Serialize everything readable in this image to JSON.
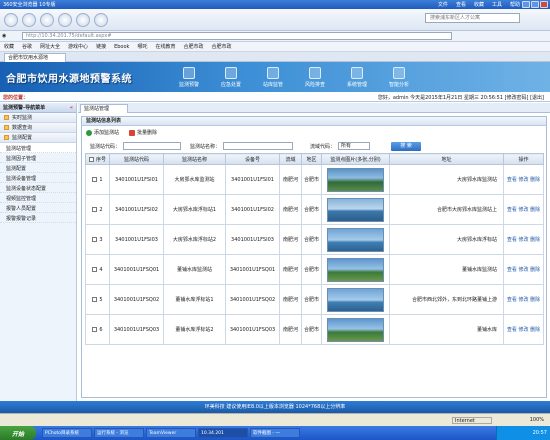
{
  "browser": {
    "title": "360安全浏览器 10专版",
    "menus": [
      "文件",
      "查看",
      "收藏",
      "工具",
      "帮助"
    ],
    "url": "http://10.34.201.75/default.aspx#",
    "search_placeholder": "搜索浦东新区人才公寓",
    "favorites": [
      "收藏",
      "谷歌",
      "网址大全",
      "游戏中心",
      "链接",
      "Ebook",
      "哪吒",
      "在线教育",
      "合肥市政",
      "合肥市政"
    ],
    "tab_label": "合肥市饮用水源地"
  },
  "banner": {
    "system_title": "合肥市饮用水源地预警系统",
    "nav": [
      "监测预警",
      "应急处置",
      "站库监管",
      "风险排查",
      "系统管理",
      "智能分析"
    ]
  },
  "status": {
    "location": "您的位置：",
    "user": "您好，admin 今天是2015年1月21日 星期三 20:56:51  [修改密码]  [退出]"
  },
  "sidebar": {
    "header": "监测预警-导航菜单",
    "toggle": "«",
    "groups": [
      "实时监测",
      "数据查询",
      "监测配置"
    ],
    "items": [
      "监测站管理",
      "监测因子管理",
      "监测配置",
      "监测设备管理",
      "监测设备状态配置",
      "视频监控管理",
      "报警人员配置",
      "报警报警记录"
    ]
  },
  "main": {
    "tab": "监测站管理",
    "panel_title": "监测站信息列表",
    "add_label": "添加监测站",
    "del_label": "批量删除",
    "filter_code_label": "监测站代码：",
    "filter_name_label": "监测站名称：",
    "filter_basin_label": "流域代码：",
    "filter_basin_value": "所有",
    "search_btn": "搜 索"
  },
  "table": {
    "headers": [
      "序号",
      "监测站代码",
      "监测站名称",
      "设备号",
      "流域",
      "地区",
      "监测点图片(多张,分别)",
      "地址",
      "操作"
    ],
    "rows": [
      {
        "no": "1",
        "code": "3401001U1FSI01",
        "name": "大房郢水库监测站",
        "dev": "3401001U1FSI01",
        "basin": "南肥河",
        "area": "合肥市",
        "addr": "大房郢水库监测站",
        "ops": "查看 修改 删除"
      },
      {
        "no": "2",
        "code": "3401001U1FSI02",
        "name": "大房郢水库浮标站1",
        "dev": "3401001U1FSI02",
        "basin": "南肥河",
        "area": "合肥市",
        "addr": "合肥市大房郢水库监测站上",
        "ops": "查看 修改 删除"
      },
      {
        "no": "3",
        "code": "3401001U1FSI03",
        "name": "大房郢水库浮标站2",
        "dev": "3401001U1FSI03",
        "basin": "南肥河",
        "area": "合肥市",
        "addr": "大房郢水库浮标站",
        "ops": "查看 修改 删除"
      },
      {
        "no": "4",
        "code": "3401001U1FSQ01",
        "name": "董铺水库监测站",
        "dev": "3401001U1FSQ01",
        "basin": "南肥河",
        "area": "合肥市",
        "addr": "董铺水库监测站",
        "ops": "查看 修改 删除"
      },
      {
        "no": "5",
        "code": "3401001U1FSQ02",
        "name": "董铺水库浮标站1",
        "dev": "3401001U1FSQ02",
        "basin": "南肥河",
        "area": "合肥市",
        "addr": "合肥市西北郊外，东到北环路董铺上游",
        "ops": "查看 修改 删除"
      },
      {
        "no": "6",
        "code": "3401001U1FSQ03",
        "name": "董铺水库浮标站2",
        "dev": "3401001U1FSQ03",
        "basin": "南肥河",
        "area": "合肥市",
        "addr": "董铺水库",
        "ops": "查看 修改 删除"
      }
    ]
  },
  "footer": "环美科技 建议使用IE8.0以上版本浏览器 1024*768以上分辨率",
  "ie_status": {
    "zone": "Internet",
    "zoom": "100%"
  },
  "taskbar": {
    "start": "开始",
    "items": [
      "PChoto目录系统",
      "运行系统 - 浏览",
      "TeamViewer",
      "10.34.201",
      "软件截图 - 一"
    ],
    "tray_time": "20:57"
  }
}
